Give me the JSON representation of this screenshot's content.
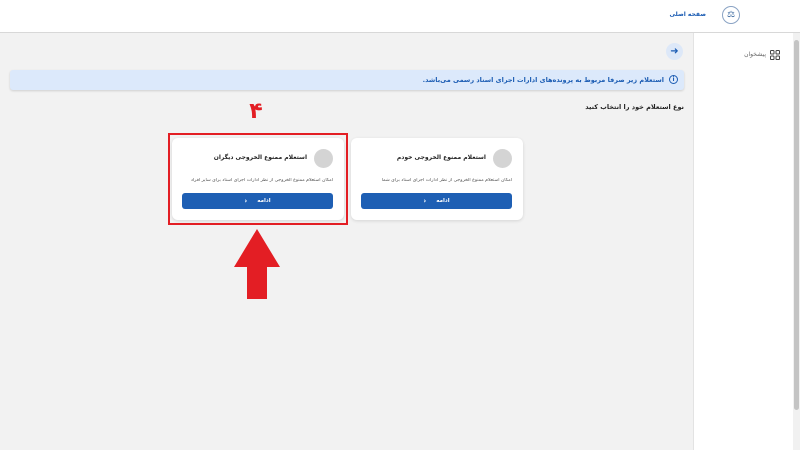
{
  "header": {
    "nav_home": "صفحه اصلی",
    "logo_icon": "seal-logo-icon"
  },
  "sidebar": {
    "item_desk": {
      "label": "پیشخوان",
      "icon": "grid-icon"
    }
  },
  "main": {
    "back_icon": "arrow-right-icon",
    "info_banner": {
      "icon": "info-icon",
      "text": "استعلام زیر صرفا مربوط به پرونده‌های ادارات اجرای اسناد رسمی می‌باشد."
    },
    "section_title": "نوع استعلام خود را انتخاب کنید",
    "cards": [
      {
        "title": "استعلام ممنوع الخروجی خودم",
        "description": "امکان استعلام ممنوع الخروجی از نظر ادارات اجرای اسناد برای شما",
        "button_label": "ادامه"
      },
      {
        "title": "استعلام ممنوع الخروجی دیگران",
        "description": "امکان استعلام ممنوع الخروجی از نظر ادارات اجرای اسناد برای سایر افراد",
        "button_label": "ادامه"
      }
    ]
  },
  "annotation": {
    "step_number": "۴",
    "color": "#e31e24"
  },
  "colors": {
    "primary": "#1e5fb4",
    "banner_bg": "#dce9fb",
    "page_bg": "#f2f2f2"
  }
}
